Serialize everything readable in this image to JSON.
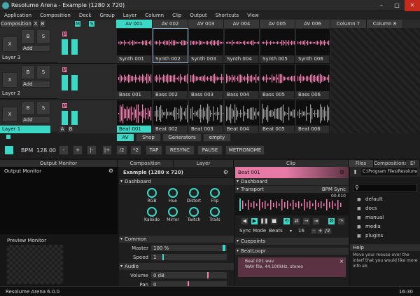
{
  "window": {
    "title": "Resolume Arena - Example (1280 x 720)"
  },
  "menu": [
    "Application",
    "Composition",
    "Deck",
    "Group",
    "Layer",
    "Column",
    "Clip",
    "Output",
    "Shortcuts",
    "View"
  ],
  "composition_bar": {
    "label": "Composition",
    "x": "X",
    "b": "B"
  },
  "columns": [
    "AV 001",
    "AV 002",
    "AV 003",
    "AV 004",
    "AV 005",
    "AV 006",
    "Column 7",
    "Column 8"
  ],
  "layers": [
    {
      "name": "Layer 3",
      "clips": [
        "Synth 001",
        "Synth 002",
        "Synth 003",
        "Synth 004",
        "Synth 005",
        "Synth 006"
      ]
    },
    {
      "name": "Layer 2",
      "clips": [
        "Bass 001",
        "Bass 002",
        "Bass 003",
        "Bass 004",
        "Bass 005",
        "Bass 006"
      ]
    },
    {
      "name": "Layer 1",
      "clips": [
        "Beat 001",
        "Beat 002",
        "Beat 003",
        "Beat 004",
        "Beat 005",
        "Beat 006"
      ]
    }
  ],
  "layer_ctrl": {
    "x": "X",
    "b": "B",
    "s": "S",
    "m": "M",
    "add": "Add",
    "a": "A"
  },
  "deck_tabs": [
    "AV",
    "Shop",
    "Generators",
    "empty"
  ],
  "transport": {
    "bpm_label": "BPM",
    "bpm": "128.00",
    "minus": "-",
    "plus": "+",
    "div2": "/2",
    "mul2": "*2",
    "tap": "TAP",
    "resync": "RESYNC",
    "pause": "PAUSE",
    "metronome": "METRONOME"
  },
  "panels": {
    "output": "Output Monitor",
    "output_inner": "Output Monitor",
    "preview": "Preview Monitor",
    "composition": "Composition",
    "layer": "Layer",
    "clip": "Clip",
    "files_tab": "Files",
    "compositions_tab": "Compositions",
    "effects_tab": "Ef"
  },
  "composition_panel": {
    "title": "Example (1280 x 720)",
    "dashboard": "Dashboard",
    "knobs": [
      "RGB",
      "Hue",
      "Distort",
      "Flip",
      "Kaleido",
      "Mirror",
      "Twitch",
      "Trails"
    ],
    "common": "Common",
    "master_label": "Master",
    "master_value": "100 %",
    "speed_label": "Speed",
    "speed_value": "1",
    "audio": "Audio",
    "volume_label": "Volume",
    "volume_value": "0 dB",
    "pan_label": "Pan",
    "pan_value": "0"
  },
  "clip_panel": {
    "clip_name": "Beat 001",
    "dashboard": "Dashboard",
    "transport": "Transport",
    "sync": "BPM Sync",
    "time": "00.010",
    "sync_mode_label": "Sync Mode",
    "sync_mode": "Beats",
    "beats": "16",
    "cuepoints": "Cuepoints",
    "beatloopr": "BeatLoopr",
    "file_name": "Beat 001.wav",
    "file_info": "WAV file, 44.100kHz, stereo"
  },
  "files_panel": {
    "path": "C:\\Program Files\\Resolume Ar",
    "folders": [
      "default",
      "docs",
      "manual",
      "media",
      "plugins"
    ],
    "help_title": "Help",
    "help_text": "Move your mouse over the interf that you would like more info ab"
  },
  "statusbar": {
    "version": "Resolume Arena 6.0.0",
    "time": "16:30"
  },
  "colors": {
    "accent": "#3bd8c6",
    "pink": "#f47fb0"
  }
}
